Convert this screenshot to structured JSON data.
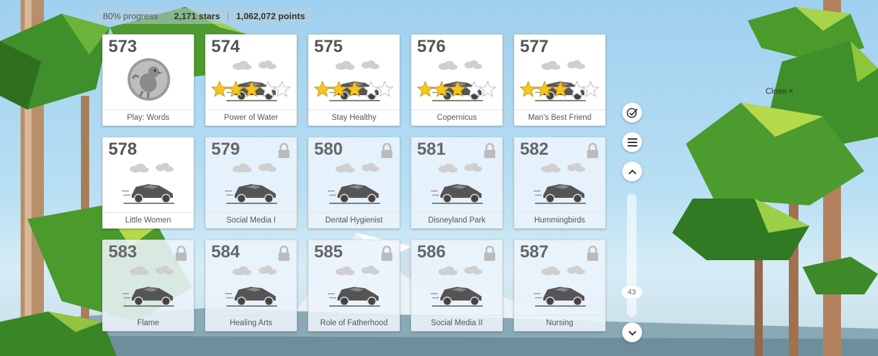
{
  "stats": {
    "progress": "80% progress",
    "stars": "2,171 stars",
    "points": "1,062,072 points",
    "separator": "|"
  },
  "close_label": "Close",
  "close_glyph": "×",
  "scroll_value": "43",
  "tiles": [
    {
      "number": "573",
      "title": "Play: Words",
      "locked": false,
      "icon": "chick-badge-icon",
      "stars": null
    },
    {
      "number": "574",
      "title": "Power of Water",
      "locked": false,
      "icon": "race-car-icon",
      "stars": 3
    },
    {
      "number": "575",
      "title": "Stay Healthy",
      "locked": false,
      "icon": "race-car-icon",
      "stars": 3
    },
    {
      "number": "576",
      "title": "Copernicus",
      "locked": false,
      "icon": "race-car-icon",
      "stars": 3
    },
    {
      "number": "577",
      "title": "Man's Best Friend",
      "locked": false,
      "icon": "race-car-icon",
      "stars": 3
    },
    {
      "number": "578",
      "title": "Little Women",
      "locked": false,
      "icon": "race-car-icon",
      "stars": 0
    },
    {
      "number": "579",
      "title": "Social Media I",
      "locked": true,
      "icon": "race-car-icon",
      "stars": 0
    },
    {
      "number": "580",
      "title": "Dental Hygienist",
      "locked": true,
      "icon": "race-car-icon",
      "stars": 0
    },
    {
      "number": "581",
      "title": "Disneyland Park",
      "locked": true,
      "icon": "race-car-icon",
      "stars": 0
    },
    {
      "number": "582",
      "title": "Hummingbirds",
      "locked": true,
      "icon": "race-car-icon",
      "stars": 0
    },
    {
      "number": "583",
      "title": "Flame",
      "locked": true,
      "icon": "race-car-icon",
      "stars": 0
    },
    {
      "number": "584",
      "title": "Healing Arts",
      "locked": true,
      "icon": "race-car-icon",
      "stars": 0
    },
    {
      "number": "585",
      "title": "Role of Fatherhood",
      "locked": true,
      "icon": "race-car-icon",
      "stars": 0
    },
    {
      "number": "586",
      "title": "Social Media II",
      "locked": true,
      "icon": "race-car-icon",
      "stars": 0
    },
    {
      "number": "587",
      "title": "Nursing",
      "locked": true,
      "icon": "race-car-icon",
      "stars": 0
    }
  ],
  "colors": {
    "star_gold": "#f7c51e",
    "star_empty": "#ffffff",
    "sky": "#9fd0ef",
    "foliage": "#3f8f2a",
    "accent_text": "#555555"
  }
}
